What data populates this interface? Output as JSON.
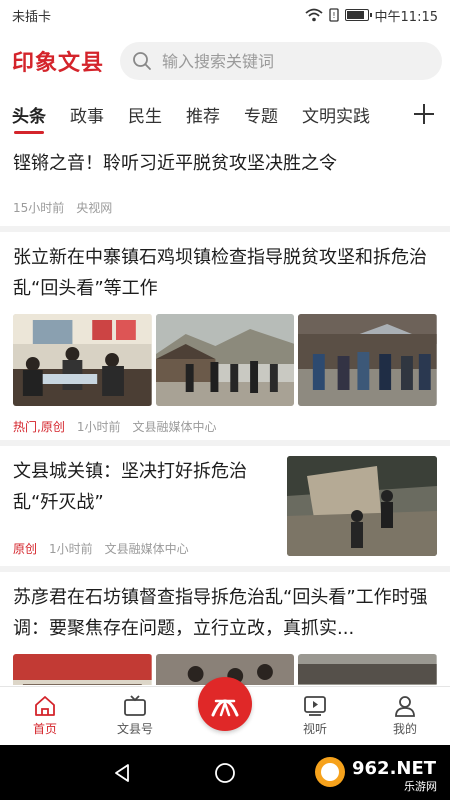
{
  "status_bar": {
    "carrier": "未插卡",
    "time": "中午11:15"
  },
  "header": {
    "logo": "印象文县",
    "search_placeholder": "输入搜索关键词"
  },
  "tabs": [
    {
      "label": "头条",
      "active": true
    },
    {
      "label": "政事",
      "active": false
    },
    {
      "label": "民生",
      "active": false
    },
    {
      "label": "推荐",
      "active": false
    },
    {
      "label": "专题",
      "active": false
    },
    {
      "label": "文明实践",
      "active": false
    }
  ],
  "articles": [
    {
      "title": "铿锵之音！聆听习近平脱贫攻坚决胜之令",
      "time": "15小时前",
      "source": "央视网"
    },
    {
      "title": "张立新在中寨镇石鸡坝镇检查指导脱贫攻坚和拆危治乱“回头看”等工作",
      "tag": "热门,原创",
      "time": "1小时前",
      "source": "文县融媒体中心"
    },
    {
      "title": "文县城关镇：坚决打好拆危治乱“歼灭战”",
      "tag": "原创",
      "time": "1小时前",
      "source": "文县融媒体中心"
    },
    {
      "title": "苏彦君在石坊镇督查指导拆危治乱“回头看”工作时强调：要聚焦存在问题，立行立改，真抓实..."
    }
  ],
  "bottom_nav": [
    {
      "label": "首页",
      "icon": "home-icon",
      "active": true
    },
    {
      "label": "文县号",
      "icon": "tv-icon",
      "active": false
    },
    {
      "label": "",
      "icon": "app-logo-icon",
      "active": false
    },
    {
      "label": "视听",
      "icon": "video-icon",
      "active": false
    },
    {
      "label": "我的",
      "icon": "user-icon",
      "active": false
    }
  ],
  "watermark": {
    "main": "962.NET",
    "sub": "乐游网"
  },
  "colors": {
    "accent": "#d4242b",
    "meta": "#9b9b9b"
  }
}
